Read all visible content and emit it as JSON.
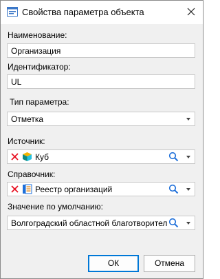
{
  "window": {
    "title": "Свойства параметра объекта"
  },
  "form": {
    "name": {
      "label": "Наименование:",
      "value": "Организация"
    },
    "identifier": {
      "label": "Идентификатор:",
      "value": "UL"
    },
    "param_type": {
      "label": "Тип параметра:",
      "value": "Отметка"
    },
    "source": {
      "label": "Источник:",
      "value": "Куб",
      "icon": "cube-icon"
    },
    "dictionary": {
      "label": "Справочник:",
      "value": "Реестр организаций",
      "icon": "dictionary-icon"
    },
    "default_value": {
      "label": "Значение по умолчанию:",
      "value": "Волгоградский областной благотворительн"
    }
  },
  "buttons": {
    "ok": "ОК",
    "cancel": "Отмена"
  },
  "colors": {
    "accent": "#0078d7",
    "clear_icon": "#e81123",
    "search_icon": "#1e6fd9"
  }
}
